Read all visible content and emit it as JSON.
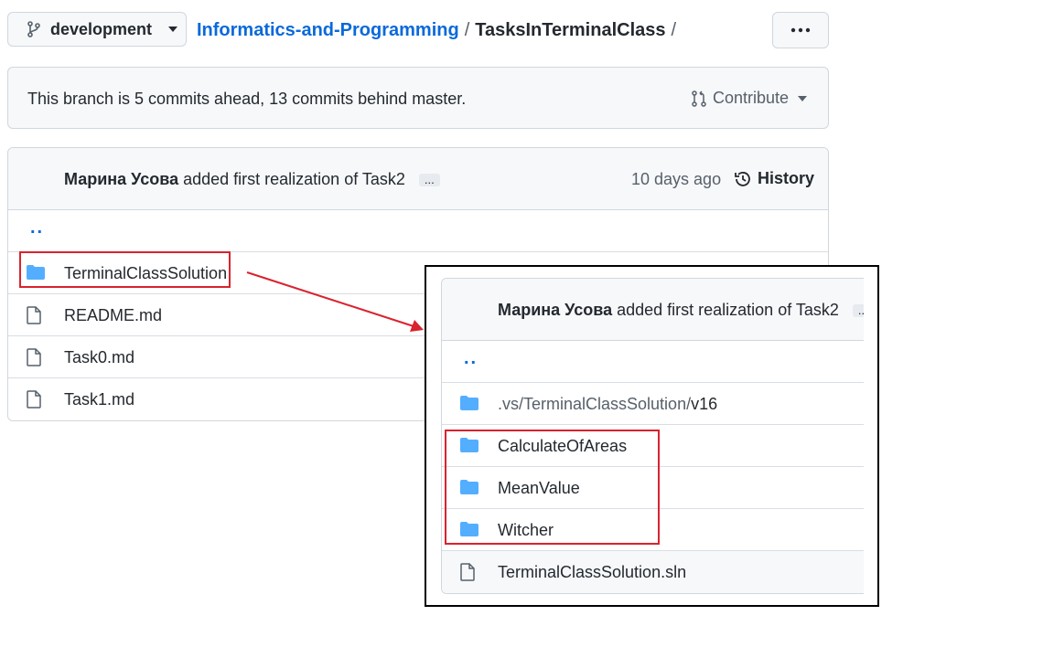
{
  "branch": {
    "name": "development"
  },
  "breadcrumb": {
    "repo": "Informatics-and-Programming",
    "separator": "/",
    "dir": "TasksInTerminalClass",
    "trailing": "/"
  },
  "info": {
    "text": "This branch is 5 commits ahead, 13 commits behind master.",
    "contribute": "Contribute"
  },
  "commit": {
    "author": "Марина Усова",
    "message": "added first realization of Task2",
    "ellipsis": "...",
    "time": "10 days ago",
    "history": "History"
  },
  "files": {
    "parent": "..",
    "items": [
      {
        "name": "TerminalClassSolution",
        "icon": "folder-icon"
      },
      {
        "name": "README.md",
        "icon": "file-icon"
      },
      {
        "name": "Task0.md",
        "icon": "file-icon"
      },
      {
        "name": "Task1.md",
        "icon": "file-icon"
      }
    ]
  },
  "inset": {
    "commit": {
      "author": "Марина Усова",
      "message": "added first realization of Task2",
      "ellipsis": "..."
    },
    "parent": "..",
    "path": {
      "dim": ".vs/TerminalClassSolution/",
      "last": "v16"
    },
    "items": [
      {
        "name": "CalculateOfAreas",
        "icon": "folder-icon"
      },
      {
        "name": "MeanValue",
        "icon": "folder-icon"
      },
      {
        "name": "Witcher",
        "icon": "folder-icon"
      },
      {
        "name": "TerminalClassSolution.sln",
        "icon": "file-icon"
      }
    ]
  },
  "colors": {
    "link": "#0969da",
    "folder": "#54aeff",
    "highlight": "#d9232e",
    "border": "#d0d7de"
  }
}
